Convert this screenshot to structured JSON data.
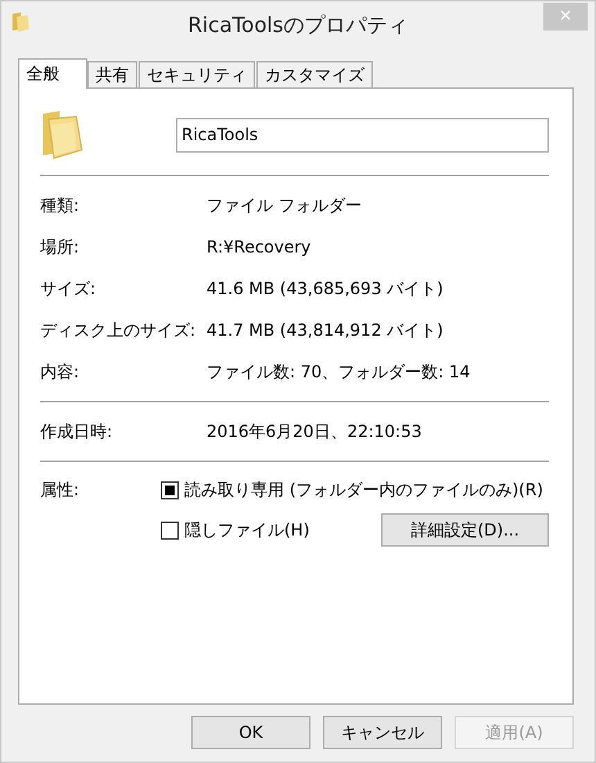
{
  "window": {
    "title": "RicaToolsのプロパティ",
    "close": "×"
  },
  "tabs": [
    {
      "label": "全般",
      "selected": true
    },
    {
      "label": "共有",
      "selected": false
    },
    {
      "label": "セキュリティ",
      "selected": false
    },
    {
      "label": "カスタマイズ",
      "selected": false
    }
  ],
  "name_field": {
    "value": "RicaTools"
  },
  "info": [
    {
      "label": "種類:",
      "value": "ファイル フォルダー"
    },
    {
      "label": "場所:",
      "value": "R:¥Recovery"
    },
    {
      "label": "サイズ:",
      "value": "41.6 MB (43,685,693 バイト)"
    },
    {
      "label": "ディスク上のサイズ:",
      "value": "41.7 MB (43,814,912 バイト)"
    },
    {
      "label": "内容:",
      "value": "ファイル数: 70、フォルダー数: 14"
    }
  ],
  "dates": [
    {
      "label": "作成日時:",
      "value": "2016年6月20日、22:10:53"
    }
  ],
  "attributes": {
    "label": "属性:",
    "options": [
      {
        "label": "読み取り専用 (フォルダー内のファイルのみ)(R)",
        "indeterminate": true
      },
      {
        "label": "隠しファイル(H)",
        "indeterminate": false
      }
    ],
    "advanced_button": "詳細設定(D)..."
  },
  "buttons": [
    {
      "label": "OK",
      "disabled": false
    },
    {
      "label": "キャンセル",
      "disabled": false
    },
    {
      "label": "適用(A)",
      "disabled": true
    }
  ]
}
